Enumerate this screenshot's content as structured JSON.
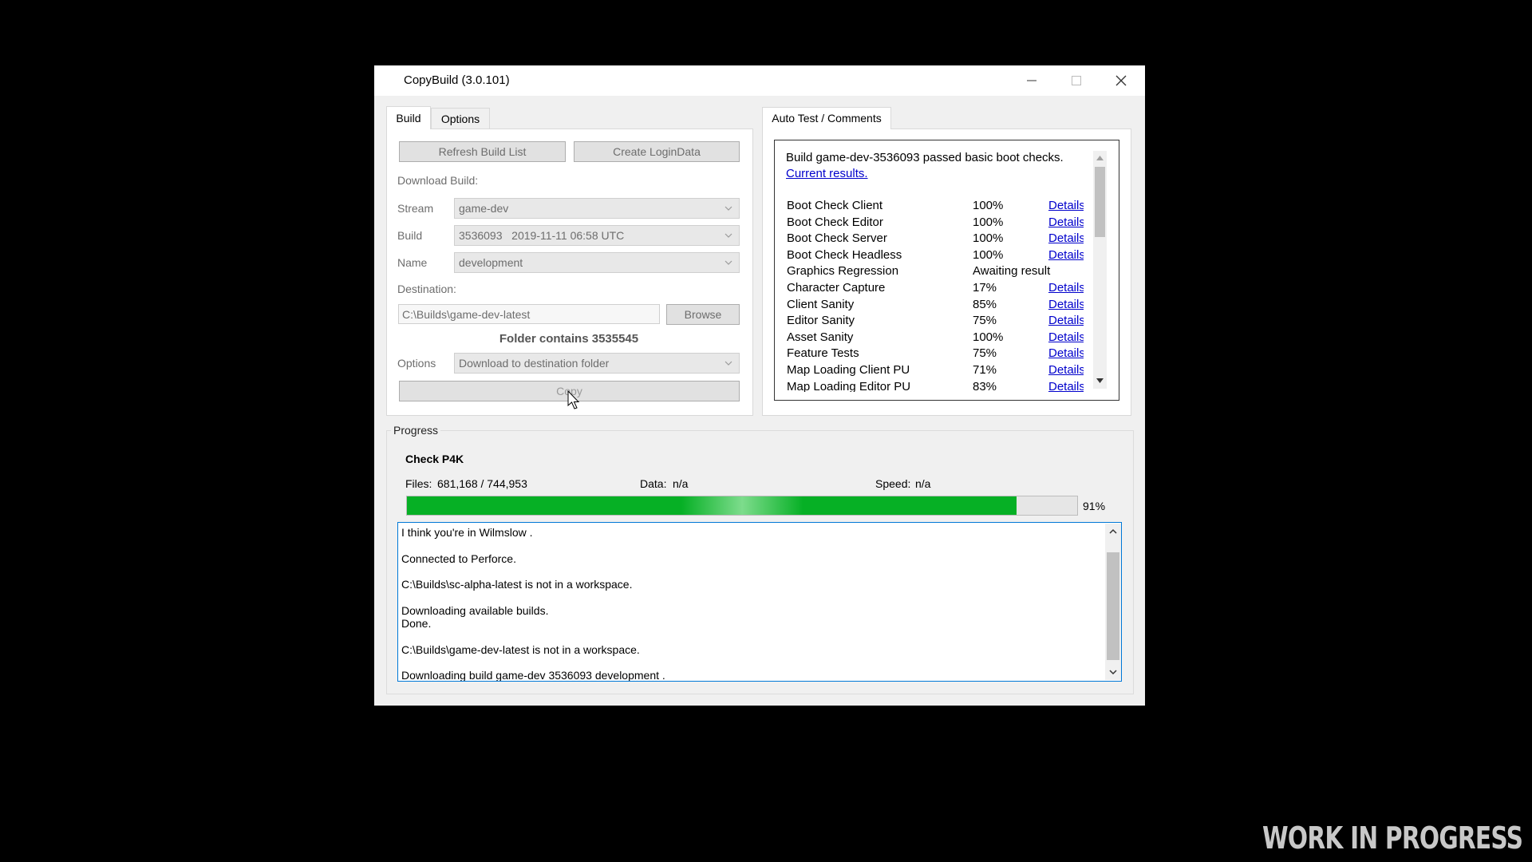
{
  "window": {
    "title": "CopyBuild (3.0.101)"
  },
  "left_tabs": [
    {
      "label": "Build",
      "active": true
    },
    {
      "label": "Options",
      "active": false
    }
  ],
  "build_panel": {
    "refresh_label": "Refresh Build List",
    "login_label": "Create LoginData",
    "download_label": "Download Build:",
    "stream_label": "Stream",
    "stream_value": "game-dev",
    "build_label": "Build",
    "build_value": "3536093   2019-11-11 06:58 UTC",
    "name_label": "Name",
    "name_value": "development",
    "destination_label": "Destination:",
    "destination_value": "C:\\Builds\\game-dev-latest",
    "browse_label": "Browse",
    "folder_info": "Folder contains 3535545",
    "options_label": "Options",
    "options_value": "Download to destination folder",
    "copy_label": "Copy"
  },
  "right_tab": {
    "label": "Auto Test / Comments"
  },
  "auto_test": {
    "summary": "Build game-dev-3536093 passed basic boot checks.",
    "results_link": "Current results.",
    "tests": [
      {
        "name": "Boot Check Client",
        "percent": "100%",
        "link": "Details"
      },
      {
        "name": "Boot Check Editor",
        "percent": "100%",
        "link": "Details"
      },
      {
        "name": "Boot Check Server",
        "percent": "100%",
        "link": "Details"
      },
      {
        "name": "Boot Check Headless",
        "percent": "100%",
        "link": "Details"
      },
      {
        "name": "Graphics Regression",
        "percent": "Awaiting result",
        "link": ""
      },
      {
        "name": "Character Capture",
        "percent": "17%",
        "link": "Details"
      },
      {
        "name": "Client Sanity",
        "percent": "85%",
        "link": "Details"
      },
      {
        "name": "Editor Sanity",
        "percent": "75%",
        "link": "Details"
      },
      {
        "name": "Asset Sanity",
        "percent": "100%",
        "link": "Details"
      },
      {
        "name": "Feature Tests",
        "percent": "75%",
        "link": "Details"
      },
      {
        "name": "Map Loading Client PU",
        "percent": "71%",
        "link": "Details"
      },
      {
        "name": "Map Loading Editor PU",
        "percent": "83%",
        "link": "Details"
      }
    ]
  },
  "progress": {
    "group_label": "Progress",
    "step": "Check P4K",
    "files_label": "Files:",
    "files_value": "681,168 / 744,953",
    "data_label": "Data:",
    "data_value": "n/a",
    "speed_label": "Speed:",
    "speed_value": "n/a",
    "percent": 91,
    "percent_text": "91%",
    "bar_color": "#06b025"
  },
  "log": {
    "lines": [
      "I think you're in Wilmslow .",
      "",
      "Connected to Perforce.",
      "",
      "C:\\Builds\\sc-alpha-latest is not in a workspace.",
      "",
      "Downloading available builds.",
      "Done.",
      "",
      "C:\\Builds\\game-dev-latest is not in a workspace.",
      "",
      "Downloading build  game-dev 3536093 development ."
    ]
  },
  "watermark": "WORK IN PROGRESS"
}
